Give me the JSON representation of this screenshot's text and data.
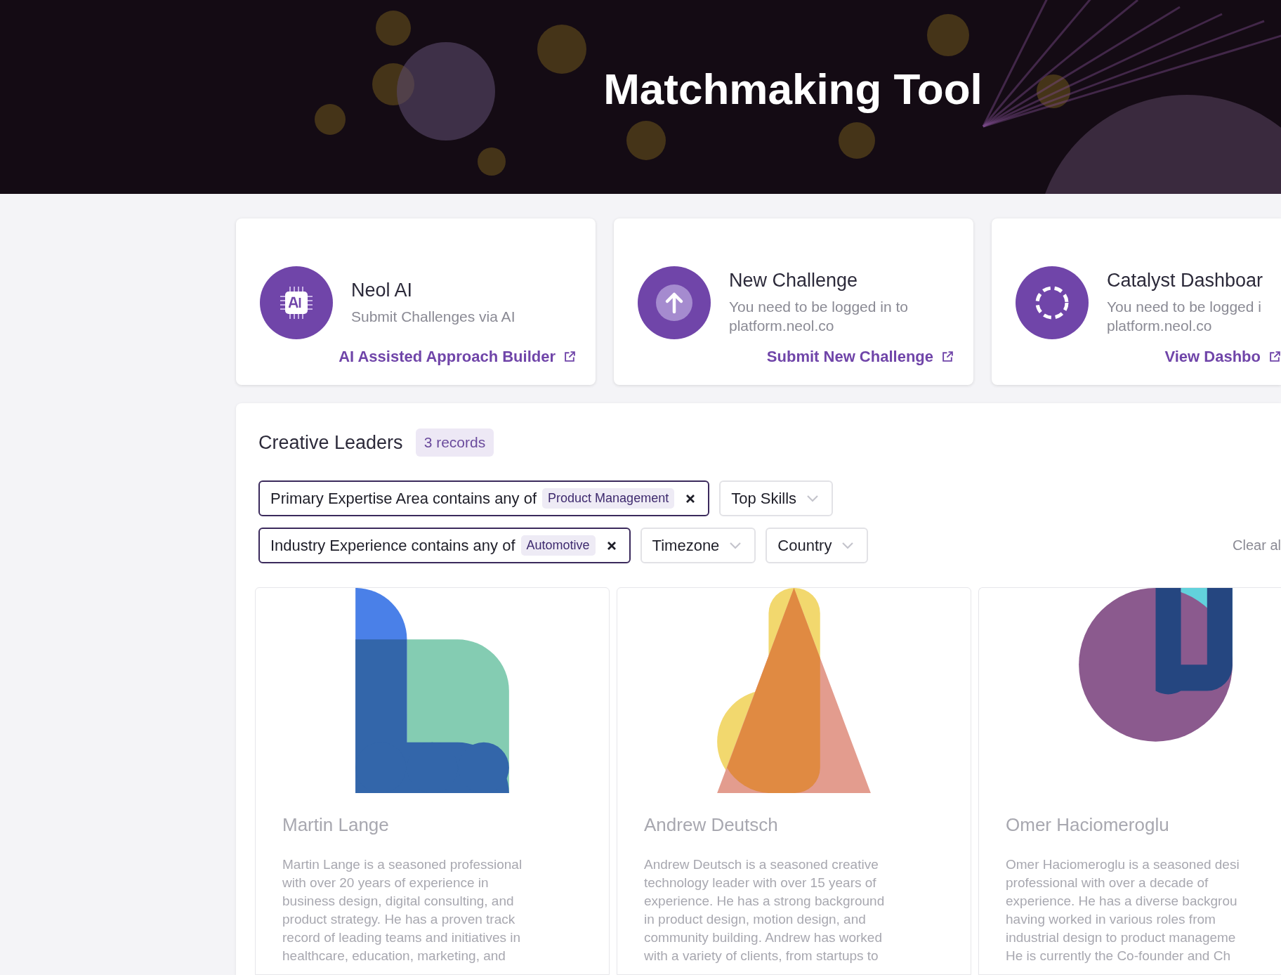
{
  "header": {
    "title": "Matchmaking Tool"
  },
  "action_cards": [
    {
      "kind": "ai",
      "title": "Neol AI",
      "subtitle_lines": [
        "Submit Challenges via AI"
      ],
      "link": "AI Assisted Approach Builder"
    },
    {
      "kind": "upload",
      "title": "New Challenge",
      "subtitle_lines": [
        "You need to be logged in to",
        "platform.neol.co"
      ],
      "link": "Submit New Challenge"
    },
    {
      "kind": "dashboard",
      "title": "Catalyst Dashboar",
      "subtitle_lines": [
        "You need to be logged i",
        "platform.neol.co"
      ],
      "link": "View Dashbo"
    }
  ],
  "panel": {
    "title": "Creative Leaders",
    "count": "3 records",
    "filter_rows": [
      [
        {
          "kind": "filter",
          "label": "Primary Expertise Area contains any of",
          "value": "Product Management"
        },
        {
          "kind": "dropdown",
          "label": "Top Skills"
        }
      ],
      [
        {
          "kind": "filter",
          "label": "Industry Experience contains any of",
          "value": "Automotive"
        },
        {
          "kind": "dropdown",
          "label": "Timezone"
        },
        {
          "kind": "dropdown",
          "label": "Country"
        }
      ]
    ],
    "clear": "Clear al",
    "leaders": [
      {
        "kind": "blocks",
        "name": "Martin Lange",
        "description_lines": [
          "Martin Lange is a seasoned professional",
          "with over 20 years of experience in",
          "business design, digital consulting, and",
          "product strategy. He has a proven track",
          "record of leading teams and initiatives in",
          "healthcare, education, marketing, and"
        ]
      },
      {
        "kind": "triangle",
        "name": "Andrew Deutsch",
        "description_lines": [
          "Andrew Deutsch is a seasoned creative",
          "technology leader with over 15 years of",
          "experience. He has a strong background",
          "in product design, motion design, and",
          "community building. Andrew has worked",
          "with a variety of clients, from startups to"
        ]
      },
      {
        "kind": "circle",
        "name": "Omer Haciomeroglu",
        "description_lines": [
          "Omer Haciomeroglu is a seasoned desi",
          "professional with over a decade of",
          "experience. He has a diverse backgrou",
          "having worked in various roles from",
          "industrial design to product manageme",
          "He is currently the Co-founder and Ch"
        ]
      }
    ]
  }
}
